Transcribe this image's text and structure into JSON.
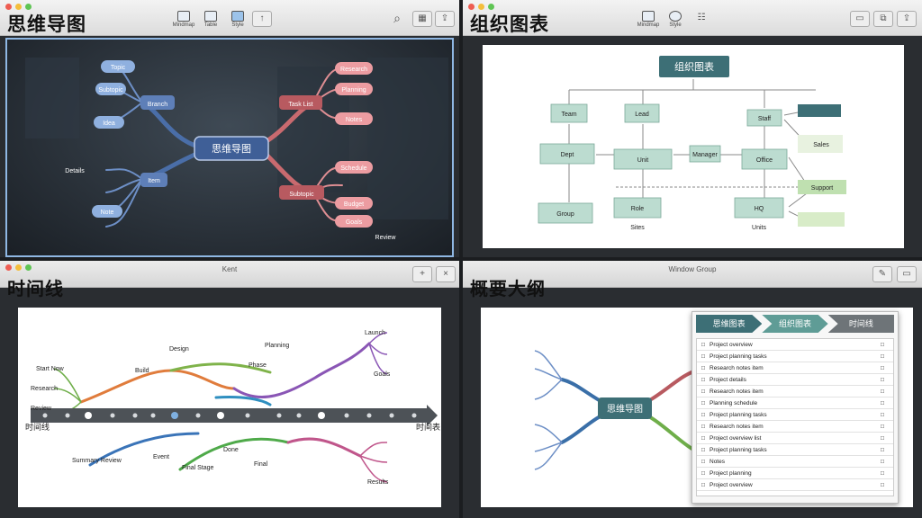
{
  "panels": {
    "mindmap": {
      "title": "思维导图",
      "toolbar": [
        "Mindmap",
        "Table",
        "Style"
      ],
      "center": "思维导图",
      "left_nodes": [
        "Topic",
        "Subtopic",
        "Idea",
        "Branch",
        "Item",
        "Note",
        "Details"
      ],
      "right_nodes": [
        "Task List",
        "Research",
        "Planning",
        "Notes",
        "Subtopic",
        "Schedule",
        "Budget",
        "Goals",
        "Review"
      ]
    },
    "orgchart": {
      "title": "组织图表",
      "toolbar": [
        "Mindmap",
        "Style"
      ],
      "root": "组织图表",
      "nodes": [
        "Team",
        "Lead",
        "Staff",
        "Dept",
        "Unit",
        "Manager",
        "Office",
        "Group",
        "Role",
        "HQ",
        "Sales",
        "Support"
      ],
      "footer": [
        "Sites",
        "Units"
      ]
    },
    "timeline": {
      "title": "时间线",
      "window_title": "Kent",
      "axis_start": "时间线",
      "axis_end": "时间表",
      "upper_labels": [
        "Start Now",
        "Research",
        "Review",
        "Build",
        "Design",
        "Phase",
        "Planning",
        "Launch",
        "Goals"
      ],
      "lower_labels": [
        "Summary Review",
        "Event",
        "Final Stage",
        "Done",
        "Final",
        "Results"
      ]
    },
    "outline": {
      "title": "概要大纲",
      "window_title": "Window Group",
      "center": "思维导图",
      "tabs": [
        "思维图表",
        "组织图表",
        "时间线"
      ],
      "rows": [
        "Project overview",
        "Project planning tasks",
        "Research notes item",
        "Project details",
        "Research notes item",
        "Planning schedule",
        "Project planning tasks",
        "Research notes item",
        "Project overview list",
        "Project planning tasks",
        "Notes",
        "Project planning",
        "Project overview"
      ]
    }
  }
}
